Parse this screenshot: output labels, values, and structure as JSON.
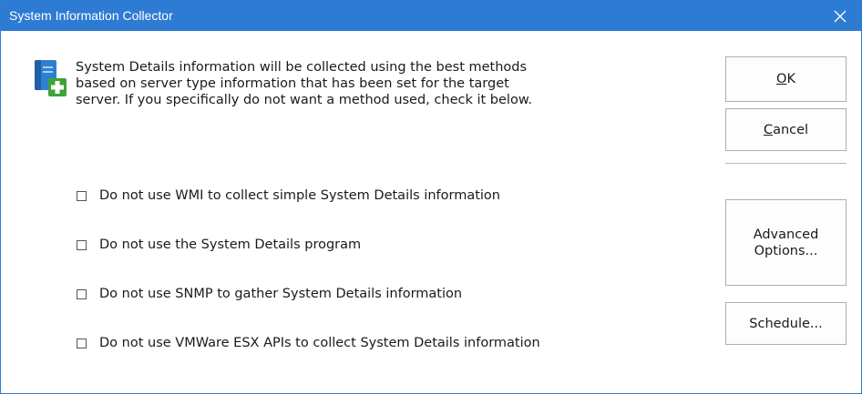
{
  "window": {
    "title": "System Information Collector"
  },
  "icons": {
    "info": "document-add-icon",
    "close": "close-icon"
  },
  "description": "System Details information will be collected using the best methods\nbased on server type information that has been set for the target\nserver.  If you specifically do not want a method used, check it below.",
  "options": [
    {
      "label": "Do not use WMI to collect simple System Details information",
      "checked": false
    },
    {
      "label": "Do not use the System Details program",
      "checked": false
    },
    {
      "label": "Do not use SNMP to gather System Details information",
      "checked": false
    },
    {
      "label": "Do not use VMWare ESX APIs to collect System Details information",
      "checked": false
    }
  ],
  "buttons": {
    "ok": {
      "accel": "O",
      "rest": "K"
    },
    "cancel": {
      "accel": "C",
      "rest": "ancel"
    },
    "advanced": "Advanced\nOptions...",
    "schedule": "Schedule..."
  },
  "colors": {
    "titlebar": "#2d7bd2",
    "window_border": "#2a7fd4"
  }
}
